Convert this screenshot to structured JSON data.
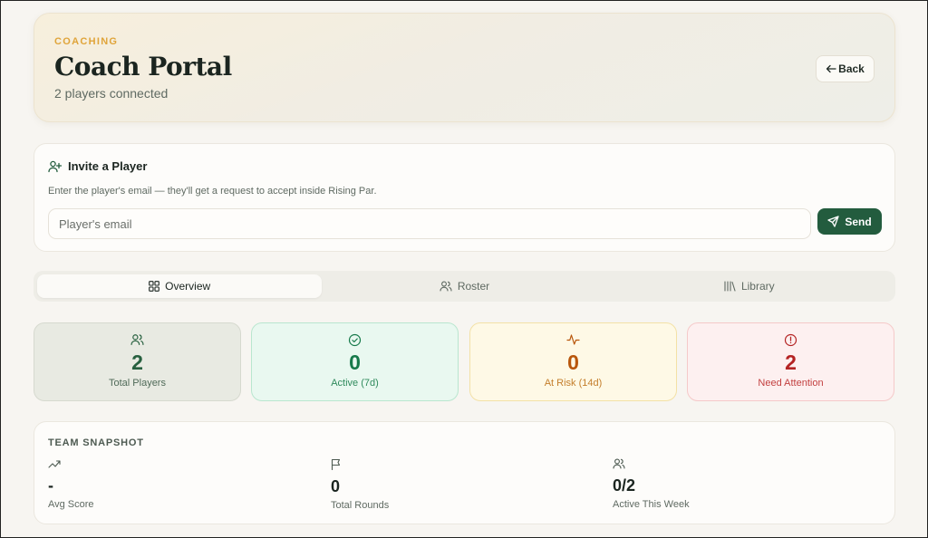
{
  "header": {
    "eyebrow": "COACHING",
    "title": "Coach Portal",
    "subtitle": "2 players connected",
    "back_label": "Back",
    "back_icon": "arrow-left-icon"
  },
  "invite": {
    "title": "Invite a Player",
    "icon": "user-plus-icon",
    "description": "Enter the player's email — they'll get a request to accept inside Rising Par.",
    "email_placeholder": "Player's email",
    "email_value": "",
    "send_label": "Send",
    "send_icon": "send-icon"
  },
  "tabs": [
    {
      "label": "Overview",
      "icon": "grid-icon",
      "active": true
    },
    {
      "label": "Roster",
      "icon": "users-icon",
      "active": false
    },
    {
      "label": "Library",
      "icon": "library-icon",
      "active": false
    }
  ],
  "stats": [
    {
      "value": "2",
      "label": "Total Players",
      "icon": "users-icon",
      "color": "#27603f"
    },
    {
      "value": "0",
      "label": "Active (7d)",
      "icon": "check-circle-icon",
      "color": "#16794a"
    },
    {
      "value": "0",
      "label": "At Risk (14d)",
      "icon": "activity-icon",
      "color": "#b8560b"
    },
    {
      "value": "2",
      "label": "Need Attention",
      "icon": "alert-circle-icon",
      "color": "#b42323"
    }
  ],
  "snapshot": {
    "title": "TEAM SNAPSHOT",
    "metrics": [
      {
        "value": "-",
        "label": "Avg Score",
        "icon": "trending-up-icon"
      },
      {
        "value": "0",
        "label": "Total Rounds",
        "icon": "flag-icon"
      },
      {
        "value": "0/2",
        "label": "Active This Week",
        "icon": "users-icon"
      }
    ]
  },
  "colors": {
    "accent": "#235c3e",
    "eyebrow": "#e0a43a",
    "background": "#f7f5f1"
  }
}
